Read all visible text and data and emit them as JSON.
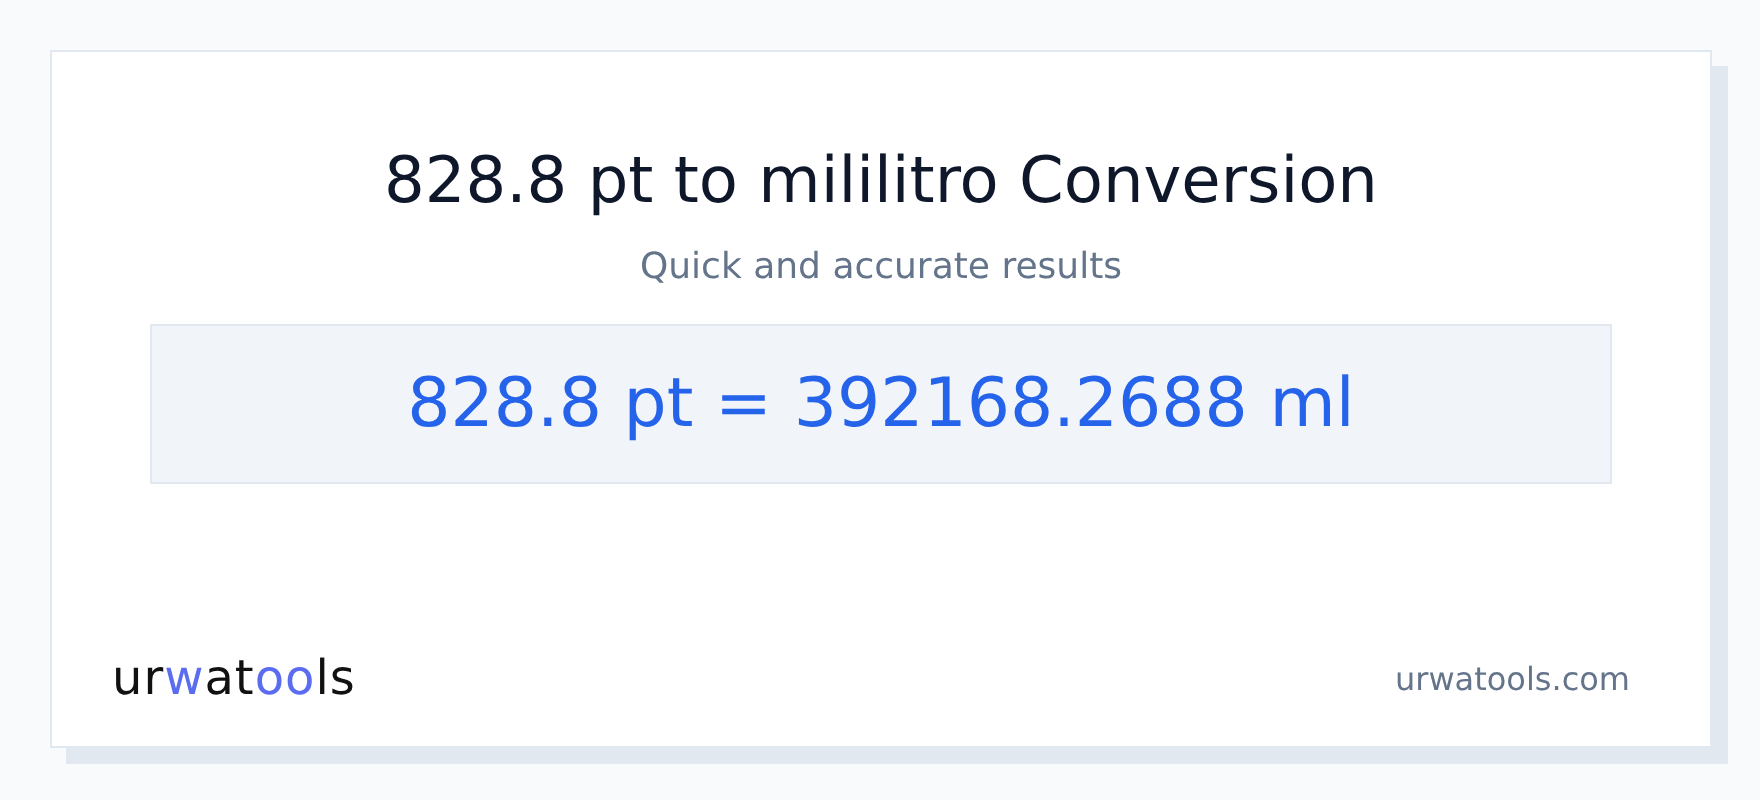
{
  "title": "828.8 pt to mililitro Conversion",
  "subtitle": "Quick and accurate results",
  "result": "828.8 pt = 392168.2688 ml",
  "logo": [
    {
      "text": "ur",
      "accent": false
    },
    {
      "text": "w",
      "accent": true
    },
    {
      "text": "at",
      "accent": false
    },
    {
      "text": "oo",
      "accent": true
    },
    {
      "text": "ls",
      "accent": false
    }
  ],
  "site": "urwatools.com"
}
